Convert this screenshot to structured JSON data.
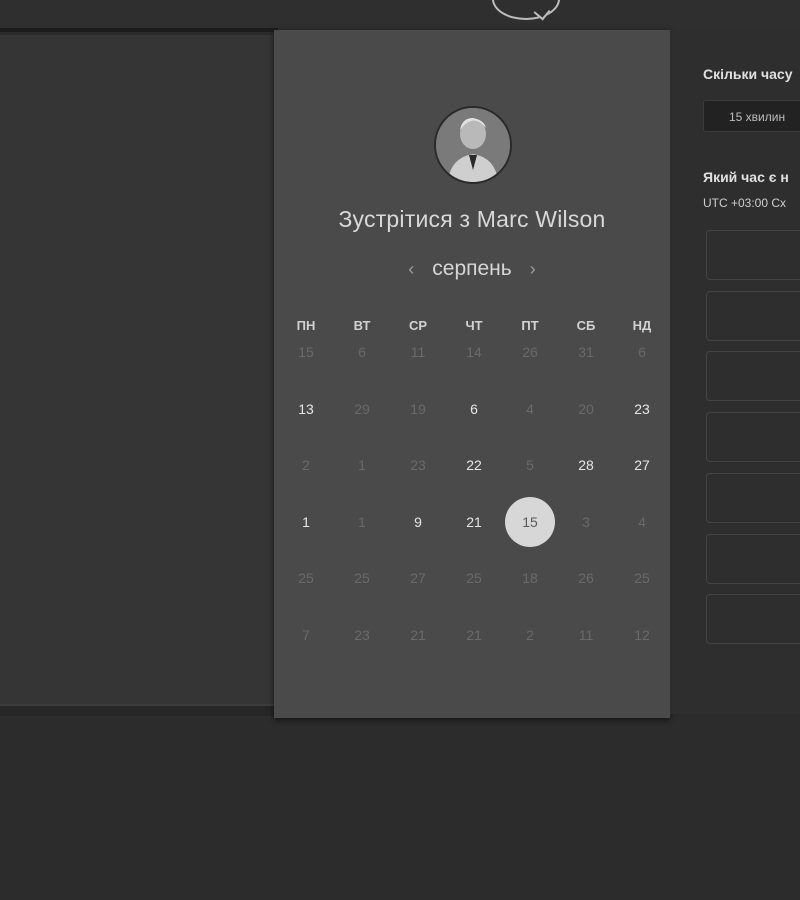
{
  "card": {
    "title": "Зустрітися з Marc Wilson",
    "month": "серпень",
    "prev_icon": "chevron-left-icon",
    "next_icon": "chevron-right-icon",
    "weekdays": [
      "ПН",
      "ВТ",
      "СР",
      "ЧТ",
      "ПТ",
      "СБ",
      "НД"
    ],
    "weeks": [
      [
        "15",
        "6",
        "11",
        "14",
        "26",
        "31",
        "6"
      ],
      [
        "13",
        "29",
        "19",
        "6",
        "4",
        "20",
        "23"
      ],
      [
        "2",
        "1",
        "23",
        "22",
        "5",
        "28",
        "27"
      ],
      [
        "1",
        "1",
        "9",
        "21",
        "15",
        "3",
        "4"
      ],
      [
        "25",
        "25",
        "27",
        "25",
        "18",
        "26",
        "25"
      ],
      [
        "7",
        "23",
        "21",
        "21",
        "2",
        "11",
        "12"
      ]
    ],
    "active": [
      [
        false,
        false,
        false,
        false,
        false,
        false,
        false
      ],
      [
        true,
        false,
        false,
        true,
        false,
        false,
        true
      ],
      [
        false,
        false,
        false,
        true,
        false,
        true,
        true
      ],
      [
        true,
        false,
        true,
        true,
        true,
        false,
        false
      ],
      [
        false,
        false,
        false,
        false,
        false,
        false,
        false
      ],
      [
        false,
        false,
        false,
        false,
        false,
        false,
        false
      ]
    ],
    "selected": {
      "week": 3,
      "day": 4
    }
  },
  "right": {
    "duration_question": "Скільки часу",
    "duration_value": "15 хвилин",
    "time_question": "Який час є н",
    "timezone": "UTC +03:00 Сх"
  }
}
